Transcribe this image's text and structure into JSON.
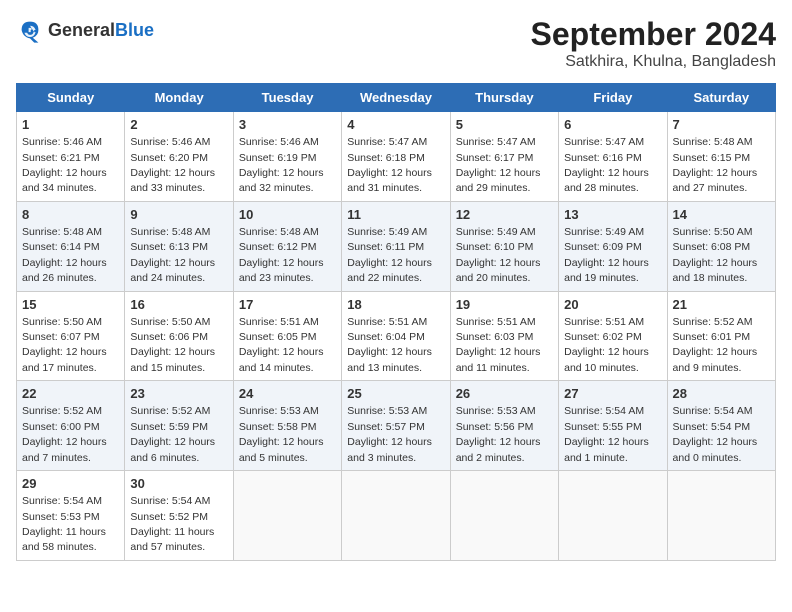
{
  "header": {
    "logo_general": "General",
    "logo_blue": "Blue",
    "title": "September 2024",
    "subtitle": "Satkhira, Khulna, Bangladesh"
  },
  "days_of_week": [
    "Sunday",
    "Monday",
    "Tuesday",
    "Wednesday",
    "Thursday",
    "Friday",
    "Saturday"
  ],
  "weeks": [
    [
      {
        "day": "1",
        "sunrise": "5:46 AM",
        "sunset": "6:21 PM",
        "daylight": "12 hours and 34 minutes."
      },
      {
        "day": "2",
        "sunrise": "5:46 AM",
        "sunset": "6:20 PM",
        "daylight": "12 hours and 33 minutes."
      },
      {
        "day": "3",
        "sunrise": "5:46 AM",
        "sunset": "6:19 PM",
        "daylight": "12 hours and 32 minutes."
      },
      {
        "day": "4",
        "sunrise": "5:47 AM",
        "sunset": "6:18 PM",
        "daylight": "12 hours and 31 minutes."
      },
      {
        "day": "5",
        "sunrise": "5:47 AM",
        "sunset": "6:17 PM",
        "daylight": "12 hours and 29 minutes."
      },
      {
        "day": "6",
        "sunrise": "5:47 AM",
        "sunset": "6:16 PM",
        "daylight": "12 hours and 28 minutes."
      },
      {
        "day": "7",
        "sunrise": "5:48 AM",
        "sunset": "6:15 PM",
        "daylight": "12 hours and 27 minutes."
      }
    ],
    [
      {
        "day": "8",
        "sunrise": "5:48 AM",
        "sunset": "6:14 PM",
        "daylight": "12 hours and 26 minutes."
      },
      {
        "day": "9",
        "sunrise": "5:48 AM",
        "sunset": "6:13 PM",
        "daylight": "12 hours and 24 minutes."
      },
      {
        "day": "10",
        "sunrise": "5:48 AM",
        "sunset": "6:12 PM",
        "daylight": "12 hours and 23 minutes."
      },
      {
        "day": "11",
        "sunrise": "5:49 AM",
        "sunset": "6:11 PM",
        "daylight": "12 hours and 22 minutes."
      },
      {
        "day": "12",
        "sunrise": "5:49 AM",
        "sunset": "6:10 PM",
        "daylight": "12 hours and 20 minutes."
      },
      {
        "day": "13",
        "sunrise": "5:49 AM",
        "sunset": "6:09 PM",
        "daylight": "12 hours and 19 minutes."
      },
      {
        "day": "14",
        "sunrise": "5:50 AM",
        "sunset": "6:08 PM",
        "daylight": "12 hours and 18 minutes."
      }
    ],
    [
      {
        "day": "15",
        "sunrise": "5:50 AM",
        "sunset": "6:07 PM",
        "daylight": "12 hours and 17 minutes."
      },
      {
        "day": "16",
        "sunrise": "5:50 AM",
        "sunset": "6:06 PM",
        "daylight": "12 hours and 15 minutes."
      },
      {
        "day": "17",
        "sunrise": "5:51 AM",
        "sunset": "6:05 PM",
        "daylight": "12 hours and 14 minutes."
      },
      {
        "day": "18",
        "sunrise": "5:51 AM",
        "sunset": "6:04 PM",
        "daylight": "12 hours and 13 minutes."
      },
      {
        "day": "19",
        "sunrise": "5:51 AM",
        "sunset": "6:03 PM",
        "daylight": "12 hours and 11 minutes."
      },
      {
        "day": "20",
        "sunrise": "5:51 AM",
        "sunset": "6:02 PM",
        "daylight": "12 hours and 10 minutes."
      },
      {
        "day": "21",
        "sunrise": "5:52 AM",
        "sunset": "6:01 PM",
        "daylight": "12 hours and 9 minutes."
      }
    ],
    [
      {
        "day": "22",
        "sunrise": "5:52 AM",
        "sunset": "6:00 PM",
        "daylight": "12 hours and 7 minutes."
      },
      {
        "day": "23",
        "sunrise": "5:52 AM",
        "sunset": "5:59 PM",
        "daylight": "12 hours and 6 minutes."
      },
      {
        "day": "24",
        "sunrise": "5:53 AM",
        "sunset": "5:58 PM",
        "daylight": "12 hours and 5 minutes."
      },
      {
        "day": "25",
        "sunrise": "5:53 AM",
        "sunset": "5:57 PM",
        "daylight": "12 hours and 3 minutes."
      },
      {
        "day": "26",
        "sunrise": "5:53 AM",
        "sunset": "5:56 PM",
        "daylight": "12 hours and 2 minutes."
      },
      {
        "day": "27",
        "sunrise": "5:54 AM",
        "sunset": "5:55 PM",
        "daylight": "12 hours and 1 minute."
      },
      {
        "day": "28",
        "sunrise": "5:54 AM",
        "sunset": "5:54 PM",
        "daylight": "12 hours and 0 minutes."
      }
    ],
    [
      {
        "day": "29",
        "sunrise": "5:54 AM",
        "sunset": "5:53 PM",
        "daylight": "11 hours and 58 minutes."
      },
      {
        "day": "30",
        "sunrise": "5:54 AM",
        "sunset": "5:52 PM",
        "daylight": "11 hours and 57 minutes."
      },
      null,
      null,
      null,
      null,
      null
    ]
  ]
}
